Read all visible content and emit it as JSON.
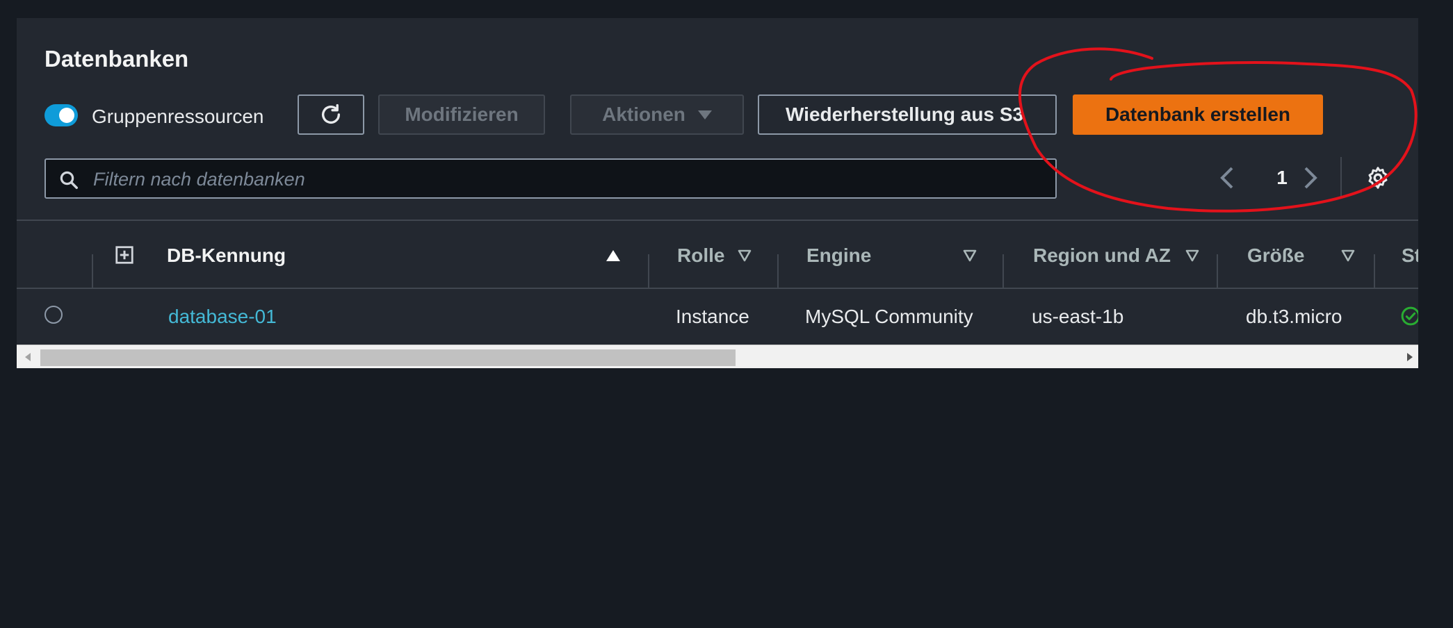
{
  "header": {
    "title": "Datenbanken",
    "group_toggle_label": "Gruppenressourcen",
    "group_toggle_on": true
  },
  "toolbar": {
    "refresh_icon": "refresh-icon",
    "modify_label": "Modifizieren",
    "actions_label": "Aktionen",
    "restore_label": "Wiederherstellung aus S3",
    "create_label": "Datenbank erstellen"
  },
  "search": {
    "placeholder": "Filtern nach datenbanken",
    "value": ""
  },
  "pagination": {
    "current_page": "1"
  },
  "table": {
    "columns": [
      "DB-Kennung",
      "Rolle",
      "Engine",
      "Region und AZ",
      "Größe",
      "St"
    ],
    "rows": [
      {
        "id": "database-01",
        "role": "Instance",
        "engine": "MySQL Community",
        "region": "us-east-1b",
        "size": "db.t3.micro",
        "status_icon": "check-circle-icon"
      }
    ]
  },
  "colors": {
    "primary_button": "#ec7211",
    "link": "#44b9d6",
    "toggle_on": "#0f9cd9",
    "annotation": "#e3121b",
    "status_ok": "#29ad32"
  }
}
